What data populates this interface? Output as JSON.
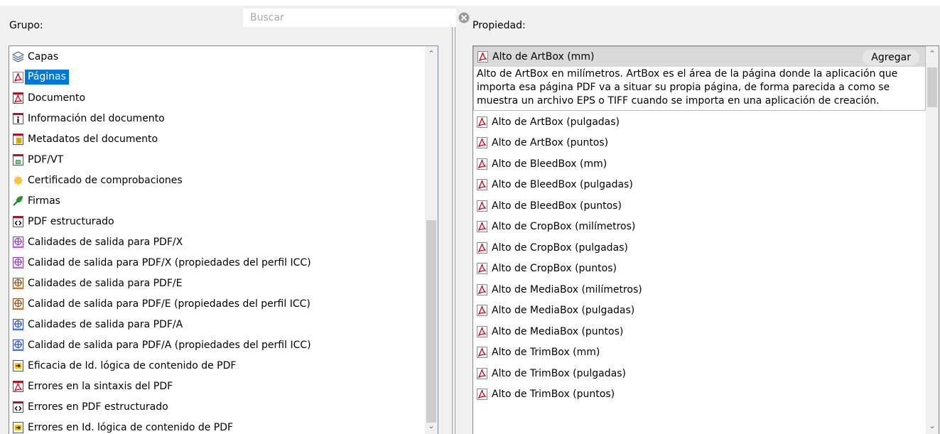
{
  "left": {
    "label": "Grupo:",
    "items": [
      {
        "label": "Capas",
        "icon": "layers-icon"
      },
      {
        "label": "Páginas",
        "icon": "pdf-icon",
        "selected": true
      },
      {
        "label": "Documento",
        "icon": "pdf-doc-icon"
      },
      {
        "label": "Información del documento",
        "icon": "info-doc-icon"
      },
      {
        "label": "Metadatos del documento",
        "icon": "metadata-icon"
      },
      {
        "label": "PDF/VT",
        "icon": "pdfvt-icon"
      },
      {
        "label": "Certificado de comprobaciones",
        "icon": "certificate-icon"
      },
      {
        "label": "Firmas",
        "icon": "signature-icon"
      },
      {
        "label": "PDF estructurado",
        "icon": "structured-pdf-icon"
      },
      {
        "label": "Calidades de salida para PDF/X",
        "icon": "output-intent-x-icon"
      },
      {
        "label": "Calidad de salida para PDF/X (propiedades del perfil ICC)",
        "icon": "output-intent-x-icon"
      },
      {
        "label": "Calidades de salida para PDF/E",
        "icon": "output-intent-e-icon"
      },
      {
        "label": "Calidad de salida para PDF/E (propiedades del perfil ICC)",
        "icon": "output-intent-e-icon"
      },
      {
        "label": "Calidades de salida para PDF/A",
        "icon": "output-intent-a-icon"
      },
      {
        "label": "Calidad de salida para PDF/A (propiedades del perfil ICC)",
        "icon": "output-intent-a-icon"
      },
      {
        "label": "Eficacia de Id. lógica de contenido de PDF",
        "icon": "logical-id-icon"
      },
      {
        "label": "Errores en la sintaxis del PDF",
        "icon": "pdf-doc-icon"
      },
      {
        "label": "Errores en PDF estructurado",
        "icon": "structured-pdf-icon"
      },
      {
        "label": "Errores en Id. lógica de contenido de PDF",
        "icon": "logical-id-icon"
      }
    ]
  },
  "right": {
    "label": "Propiedad:",
    "search_placeholder": "Buscar",
    "selected": {
      "label": "Alto de ArtBox (mm)",
      "add_label": "Agregar",
      "description": "Alto de ArtBox en milímetros. ArtBox es el área de la página donde la aplicación que importa esa página PDF va a situar su propia página, de forma parecida a como se muestra un archivo EPS o TIFF cuando se importa en una aplicación de creación."
    },
    "items": [
      "Alto de ArtBox (pulgadas)",
      "Alto de ArtBox (puntos)",
      "Alto de BleedBox (mm)",
      "Alto de BleedBox (pulgadas)",
      "Alto de BleedBox (puntos)",
      "Alto de CropBox (milímetros)",
      "Alto de CropBox (pulgadas)",
      "Alto de CropBox (puntos)",
      "Alto de MediaBox (milímetros)",
      "Alto de MediaBox (pulgadas)",
      "Alto de MediaBox (puntos)",
      "Alto de TrimBox (mm)",
      "Alto de TrimBox (pulgadas)",
      "Alto de TrimBox (puntos)"
    ]
  },
  "colors": {
    "selection": "#0078d7",
    "pdf_red": "#d0021b"
  }
}
